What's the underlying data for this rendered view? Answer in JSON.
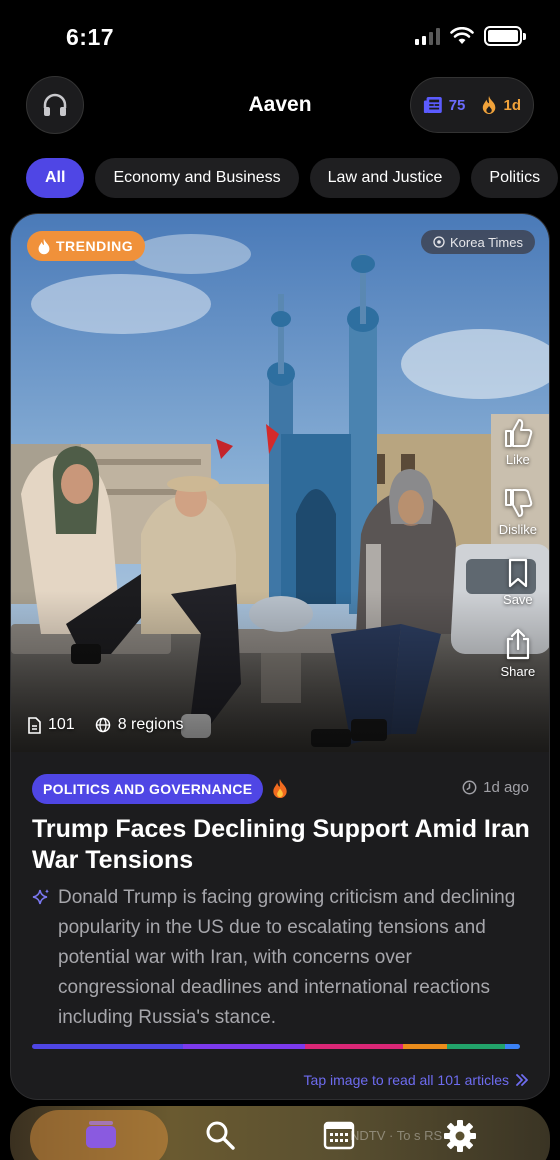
{
  "status_bar": {
    "time": "6:17"
  },
  "header": {
    "title": "Aaven",
    "articles_count": "75",
    "streak": "1d"
  },
  "filters": [
    {
      "label": "All",
      "active": true
    },
    {
      "label": "Economy and Business",
      "active": false
    },
    {
      "label": "Law and Justice",
      "active": false
    },
    {
      "label": "Politics",
      "active": false
    }
  ],
  "card": {
    "trending_label": "TRENDING",
    "source": "Korea Times",
    "actions": {
      "like": "Like",
      "dislike": "Dislike",
      "save": "Save",
      "share": "Share"
    },
    "article_count": "101",
    "regions": "8 regions",
    "category": "POLITICS AND GOVERNANCE",
    "time_ago": "1d ago",
    "headline": "Trump Faces Declining Support Amid Iran War Tensions",
    "summary": "Donald Trump is facing growing criticism and declining popularity in the US due to escalating tensions and potential war with Iran, with concerns over congressional deadlines and international reactions including Russia's stance.",
    "read_all": "Tap image to read all 101 articles",
    "coverage_colors": [
      "#4f46e5",
      "#7c3aed",
      "#db2777",
      "#ea8c1c",
      "#22a36a",
      "#3b82f6"
    ]
  },
  "tabbar": {
    "ghost_text": "NDTV · To    s RS"
  },
  "colors": {
    "accent": "#4f46e5",
    "trending": "#f0913a",
    "streak": "#f0a23a"
  }
}
